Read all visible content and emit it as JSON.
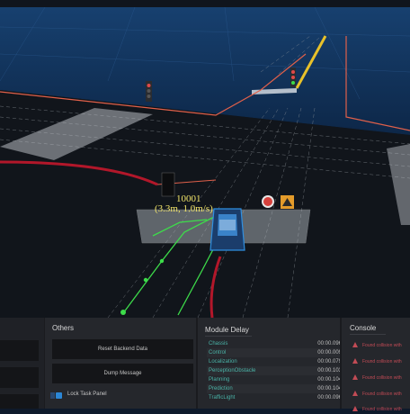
{
  "scene": {
    "obstacle_id": "10001",
    "obstacle_info": "(3.3m, 1.0m/s)"
  },
  "others": {
    "title": "Others",
    "reset_label": "Reset Backend Data",
    "dump_label": "Dump Message",
    "lock_label": "Lock Task Panel"
  },
  "module_delay": {
    "title": "Module Delay",
    "rows": [
      {
        "name": "Chassis",
        "time": "00:00.096"
      },
      {
        "name": "Control",
        "time": "00:00.009"
      },
      {
        "name": "Localization",
        "time": "00:00.079"
      },
      {
        "name": "PerceptionObstacle",
        "time": "00:00.103"
      },
      {
        "name": "Planning",
        "time": "00:00.104"
      },
      {
        "name": "Prediction",
        "time": "00:00.104"
      },
      {
        "name": "TrafficLight",
        "time": "00:00.096"
      }
    ]
  },
  "console": {
    "title": "Console",
    "messages": [
      "Found collision with",
      "Found collision with",
      "Found collision with",
      "Found collision with",
      "Found collision with"
    ]
  },
  "colors": {
    "accent_teal": "#4ab3a7",
    "warning_red": "#c24b55",
    "route_green": "#3ddc4a",
    "lane_orange": "#e0604a"
  }
}
